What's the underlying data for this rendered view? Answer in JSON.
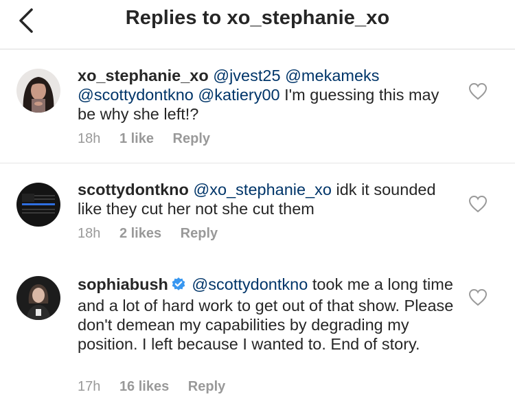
{
  "header": {
    "title": "Replies to xo_stephanie_xo",
    "back_icon": "chevron-left-icon"
  },
  "comments": [
    {
      "username": "xo_stephanie_xo",
      "verified": false,
      "mentions": [
        "@jvest25",
        "@mekameks",
        "@scottydontkno",
        "@katiery00"
      ],
      "text": "I'm guessing this may be why she left!?",
      "time": "18h",
      "likes": "1 like",
      "reply_label": "Reply",
      "avatar_icon": "user-avatar-icon"
    },
    {
      "username": "scottydontkno",
      "verified": false,
      "mentions": [
        "@xo_stephanie_xo"
      ],
      "text": "idk it sounded like they cut her not she cut them",
      "time": "18h",
      "likes": "2 likes",
      "reply_label": "Reply",
      "avatar_icon": "thin-blue-line-flag-avatar-icon"
    },
    {
      "username": "sophiabush",
      "verified": true,
      "mentions": [
        "@scottydontkno"
      ],
      "text": "took me a long time and a lot of hard work to get out of that show. Please don't demean my capabilities by degrading my position. I left because I wanted to. End of story.",
      "time": "17h",
      "likes": "16 likes",
      "reply_label": "Reply",
      "avatar_icon": "user-avatar-icon"
    }
  ],
  "colors": {
    "text": "#262626",
    "mention": "#003569",
    "meta": "#999999",
    "verified": "#3897f0",
    "divider": "#dbdbdb"
  }
}
